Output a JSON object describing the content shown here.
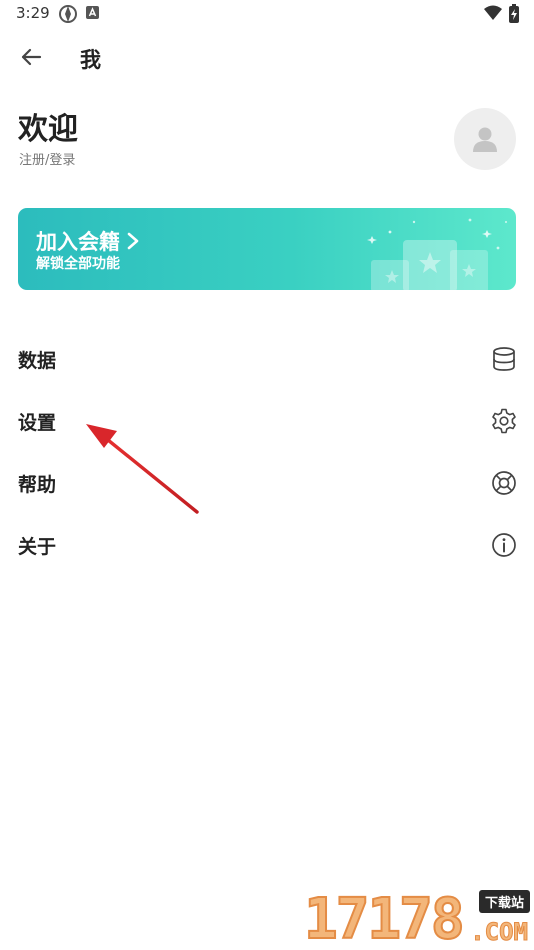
{
  "status_bar": {
    "time": "3:29"
  },
  "app_bar": {
    "title": "我"
  },
  "profile": {
    "welcome": "欢迎",
    "login_link": "注册/登录"
  },
  "banner": {
    "title": "加入会籍",
    "subtitle": "解锁全部功能"
  },
  "menu": [
    {
      "label": "数据",
      "icon": "database-icon"
    },
    {
      "label": "设置",
      "icon": "gear-icon"
    },
    {
      "label": "帮助",
      "icon": "lifebuoy-icon"
    },
    {
      "label": "关于",
      "icon": "info-icon"
    }
  ],
  "watermark": {
    "digits": "17178",
    "tag": "下载站",
    "suffix": ".COM"
  },
  "colors": {
    "banner_start": "#2cbcbd",
    "banner_end": "#5de8cc",
    "annotation_arrow": "#d9262b",
    "watermark": "#f3b67a"
  }
}
